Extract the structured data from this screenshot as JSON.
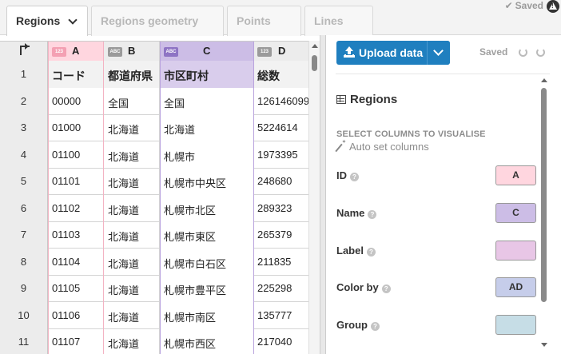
{
  "tabs": [
    {
      "label": "Regions",
      "active": true
    },
    {
      "label": "Regions geometry",
      "active": false
    },
    {
      "label": "Points",
      "active": false
    },
    {
      "label": "Lines",
      "active": false
    }
  ],
  "top_status": {
    "saved_label": "Saved"
  },
  "grid": {
    "columns": [
      {
        "letter": "A",
        "type": "123"
      },
      {
        "letter": "B",
        "type": "ABC"
      },
      {
        "letter": "C",
        "type": "ABC"
      },
      {
        "letter": "D",
        "type": "123"
      }
    ],
    "rows": [
      {
        "num": "1",
        "a": "コード",
        "b": "都道府県",
        "c": "市区町村",
        "d": "総数"
      },
      {
        "num": "2",
        "a": "00000",
        "b": "全国",
        "c": "全国",
        "d": "126146099"
      },
      {
        "num": "3",
        "a": "01000",
        "b": "北海道",
        "c": "北海道",
        "d": "5224614"
      },
      {
        "num": "4",
        "a": "01100",
        "b": "北海道",
        "c": "札幌市",
        "d": "1973395"
      },
      {
        "num": "5",
        "a": "01101",
        "b": "北海道",
        "c": "札幌市中央区",
        "d": "248680"
      },
      {
        "num": "6",
        "a": "01102",
        "b": "北海道",
        "c": "札幌市北区",
        "d": "289323"
      },
      {
        "num": "7",
        "a": "01103",
        "b": "北海道",
        "c": "札幌市東区",
        "d": "265379"
      },
      {
        "num": "8",
        "a": "01104",
        "b": "北海道",
        "c": "札幌市白石区",
        "d": "211835"
      },
      {
        "num": "9",
        "a": "01105",
        "b": "北海道",
        "c": "札幌市豊平区",
        "d": "225298"
      },
      {
        "num": "10",
        "a": "01106",
        "b": "北海道",
        "c": "札幌市南区",
        "d": "135777"
      },
      {
        "num": "11",
        "a": "01107",
        "b": "北海道",
        "c": "札幌市西区",
        "d": "217040"
      }
    ]
  },
  "panel": {
    "upload_label": "Upload data",
    "saved_label": "Saved",
    "section_title": "Regions",
    "select_heading": "SELECT COLUMNS TO VISUALISE",
    "auto_set_label": "Auto set columns",
    "fields": [
      {
        "label": "ID",
        "value": "A",
        "color": "#ffd6df"
      },
      {
        "label": "Name",
        "value": "C",
        "color": "#ccbde6"
      },
      {
        "label": "Label",
        "value": "",
        "color": "#e8c6e6"
      },
      {
        "label": "Color by",
        "value": "AD",
        "color": "#c6cdea"
      },
      {
        "label": "Group",
        "value": "",
        "color": "#c6dde6"
      }
    ]
  },
  "colors": {
    "accent": "#1f7fbf",
    "colA": "#ffd6df",
    "colC": "#ccbde6"
  }
}
